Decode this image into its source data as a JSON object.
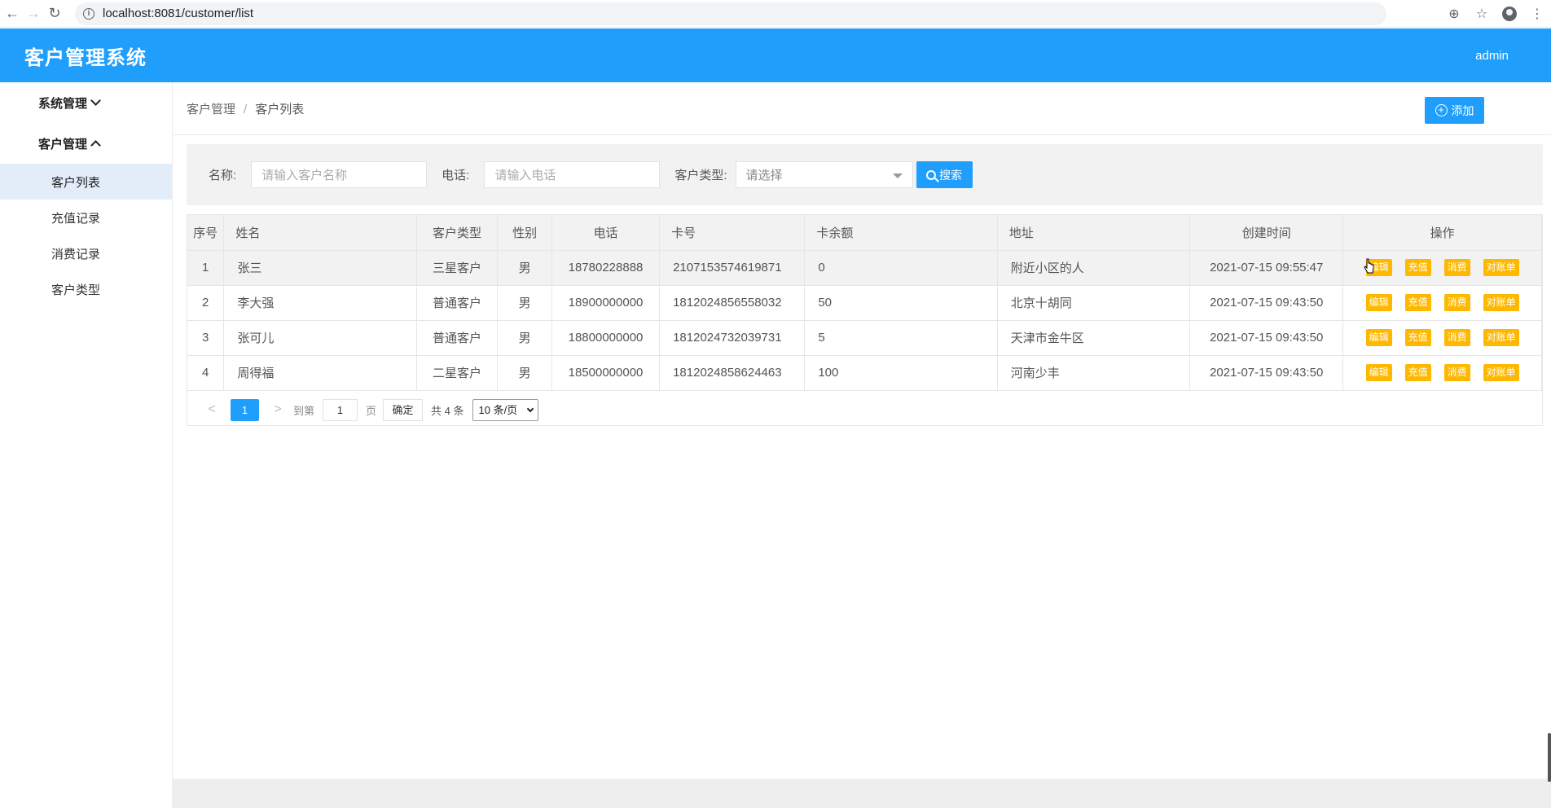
{
  "browser": {
    "url": "localhost:8081/customer/list"
  },
  "header": {
    "title": "客户管理系统",
    "user": "admin"
  },
  "sidebar": {
    "groups": [
      {
        "label": "系统管理"
      },
      {
        "label": "客户管理"
      }
    ],
    "items": [
      {
        "label": "客户列表"
      },
      {
        "label": "充值记录"
      },
      {
        "label": "消费记录"
      },
      {
        "label": "客户类型"
      }
    ]
  },
  "breadcrumb": {
    "parent": "客户管理",
    "separator": "/",
    "current": "客户列表"
  },
  "toolbar": {
    "add_label": "添加"
  },
  "search": {
    "name_label": "名称:",
    "name_placeholder": "请输入客户名称",
    "phone_label": "电话:",
    "phone_placeholder": "请输入电话",
    "type_label": "客户类型:",
    "type_placeholder": "请选择",
    "search_label": "搜索"
  },
  "table": {
    "columns": [
      "序号",
      "姓名",
      "客户类型",
      "性别",
      "电话",
      "卡号",
      "卡余额",
      "地址",
      "创建时间",
      "操作"
    ],
    "actions": [
      "编辑",
      "充值",
      "消费",
      "对账单"
    ],
    "rows": [
      {
        "idx": "1",
        "name": "张三",
        "type": "三星客户",
        "gender": "男",
        "phone": "18780228888",
        "card": "2107153574619871",
        "balance": "0",
        "address": "附近小区的人",
        "created": "2021-07-15 09:55:47"
      },
      {
        "idx": "2",
        "name": "李大强",
        "type": "普通客户",
        "gender": "男",
        "phone": "18900000000",
        "card": "1812024856558032",
        "balance": "50",
        "address": "北京十胡同",
        "created": "2021-07-15 09:43:50"
      },
      {
        "idx": "3",
        "name": "张可儿",
        "type": "普通客户",
        "gender": "男",
        "phone": "18800000000",
        "card": "1812024732039731",
        "balance": "5",
        "address": "天津市金牛区",
        "created": "2021-07-15 09:43:50"
      },
      {
        "idx": "4",
        "name": "周得福",
        "type": "二星客户",
        "gender": "男",
        "phone": "18500000000",
        "card": "1812024858624463",
        "balance": "100",
        "address": "河南少丰",
        "created": "2021-07-15 09:43:50"
      }
    ]
  },
  "pager": {
    "prev": "<",
    "current_page": "1",
    "next": ">",
    "goto_label": "到第",
    "goto_value": "1",
    "page_unit": "页",
    "confirm_label": "确定",
    "total_label": "共 4 条",
    "page_size": "10 条/页"
  }
}
